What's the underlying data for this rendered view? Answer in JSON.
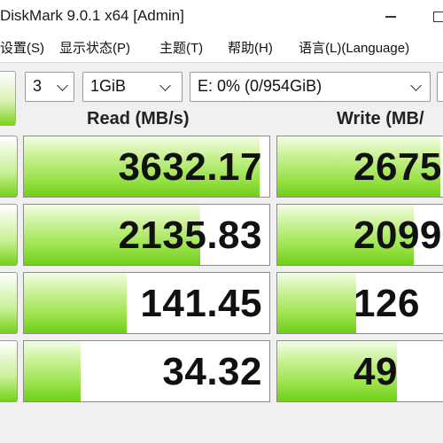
{
  "window": {
    "title": "DiskMark 9.0.1 x64 [Admin]"
  },
  "menu": {
    "items": [
      "设置(S)",
      "显示状态(P)",
      "主题(T)",
      "帮助(H)",
      "语言(L)(Language)"
    ]
  },
  "controls": {
    "test_count": "3",
    "test_size": "1GiB",
    "drive": "E: 0% (0/954GiB)"
  },
  "headers": {
    "read": "Read (MB/s)",
    "write": "Write (MB/"
  },
  "results": [
    {
      "read": "3632.17",
      "write": "2675",
      "read_level": 0.96,
      "write_level": 0.93
    },
    {
      "read": "2135.83",
      "write": "2099",
      "read_level": 0.72,
      "write_level": 0.78
    },
    {
      "read": "141.45",
      "write": "126",
      "read_level": 0.42,
      "write_level": 0.45
    },
    {
      "read": "34.32",
      "write": "49",
      "read_level": 0.23,
      "write_level": 0.68
    }
  ],
  "colors": {
    "bar_green": "#7ed321",
    "panel_bg": "#f0f0f0"
  }
}
